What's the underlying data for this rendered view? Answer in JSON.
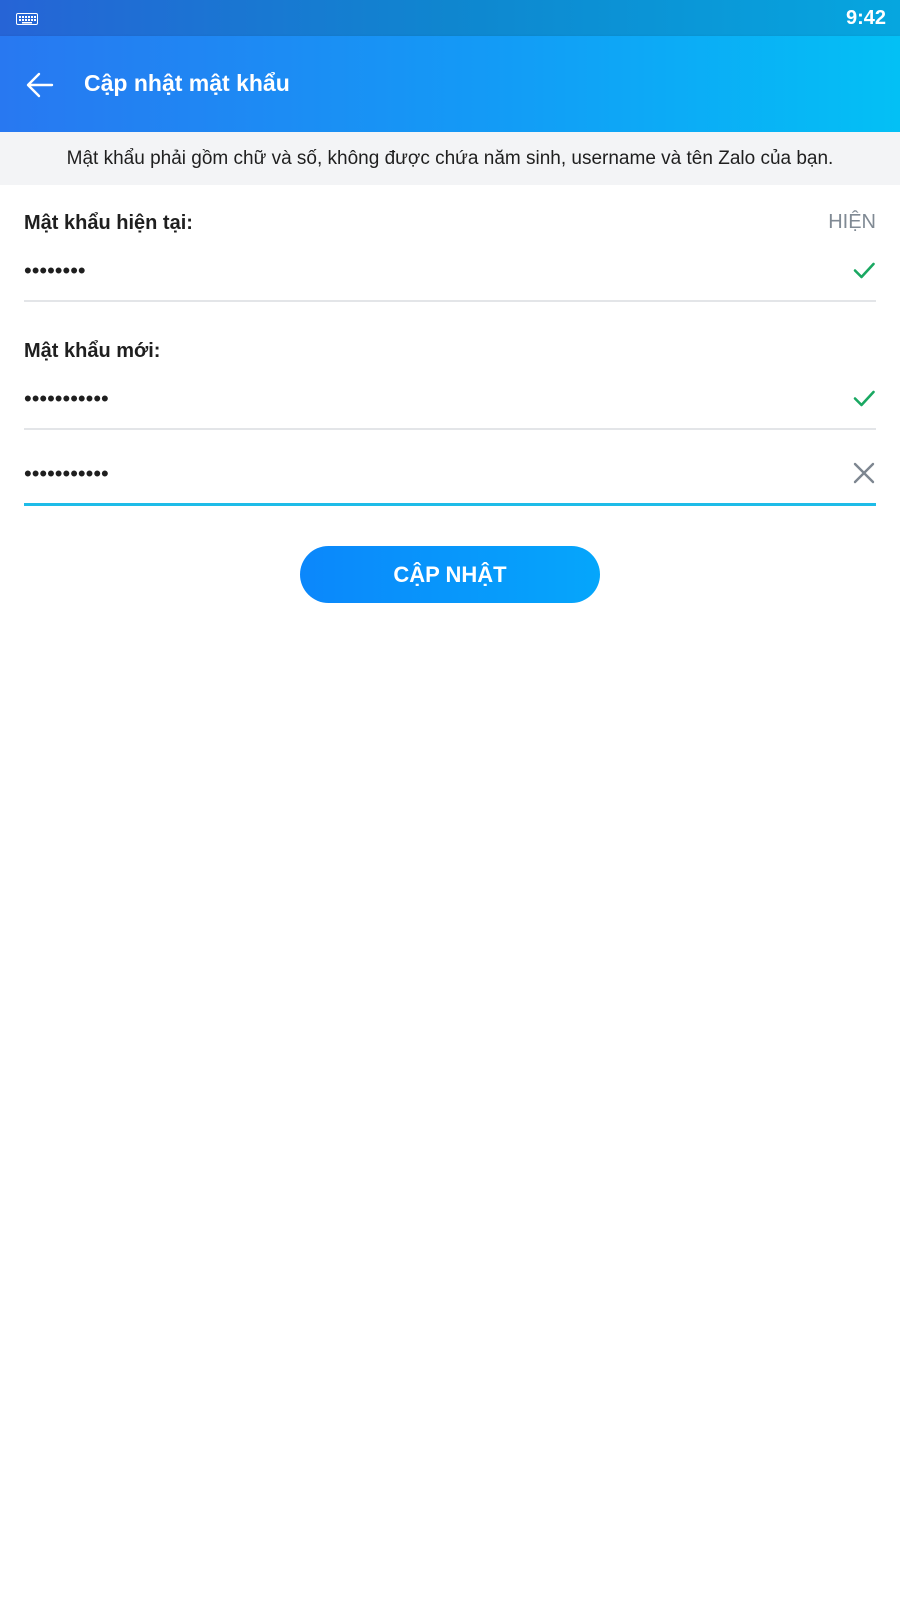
{
  "status_bar": {
    "time": "9:42",
    "icon": "keyboard-icon"
  },
  "header": {
    "title": "Cập nhật mật khẩu",
    "back_icon": "arrow-left-icon"
  },
  "hint": "Mật khẩu phải gồm chữ và số, không được chứa năm sinh, username và tên Zalo của bạn.",
  "current_password": {
    "label": "Mật khẩu hiện tại:",
    "show_label": "HIỆN",
    "value": "••••••••",
    "status_icon": "check-icon"
  },
  "new_password": {
    "label": "Mật khẩu mới:",
    "value": "•••••••••••",
    "status_icon": "check-icon"
  },
  "confirm_password": {
    "value": "•••••••••••",
    "status_icon": "clear-icon"
  },
  "submit_label": "CẬP NHẬT",
  "colors": {
    "accent": "#1ebce8",
    "check": "#1aa862",
    "button": "#0b87fb"
  }
}
